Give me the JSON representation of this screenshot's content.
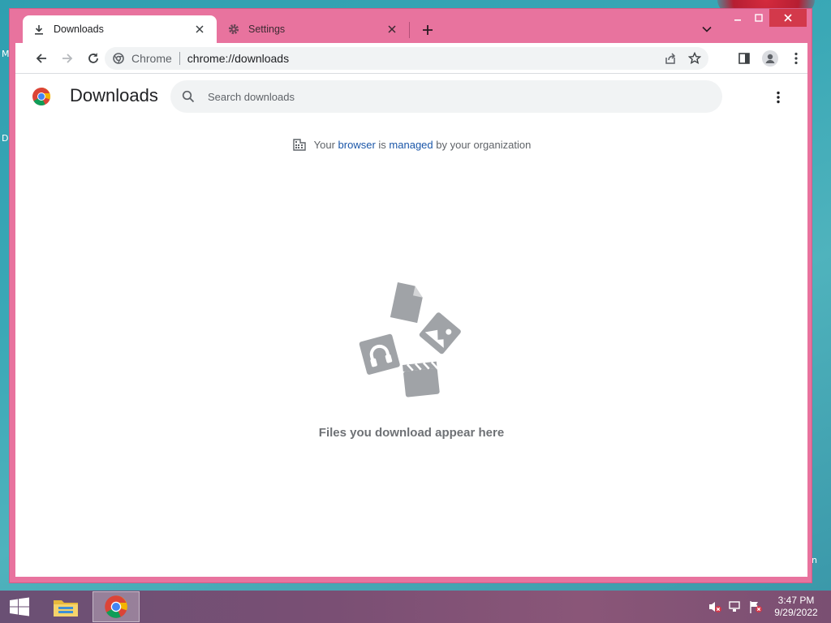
{
  "desktop": {
    "frag_top": "M",
    "frag_mid": "D",
    "frag_right": "n"
  },
  "browser": {
    "tabs": [
      {
        "title": "Downloads",
        "icon": "download-icon",
        "active": true
      },
      {
        "title": "Settings",
        "icon": "gear-icon",
        "active": false
      }
    ],
    "frame_color": "#e8739e",
    "omnibox": {
      "chip": "Chrome",
      "url": "chrome://downloads"
    }
  },
  "downloads_page": {
    "title": "Downloads",
    "search_placeholder": "Search downloads",
    "managed_notice": {
      "prefix": "Your ",
      "link1": "browser",
      "middle": " is ",
      "link2": "managed",
      "suffix": " by your organization"
    },
    "empty_message": "Files you download appear here"
  },
  "taskbar": {
    "clock_time": "3:47 PM",
    "clock_date": "9/29/2022",
    "apps": [
      "file-explorer",
      "chrome"
    ]
  }
}
